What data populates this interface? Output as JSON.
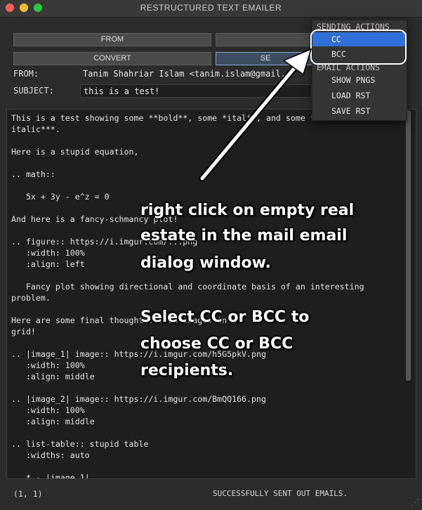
{
  "window": {
    "title": "RESTRUCTURED TEXT EMAILER"
  },
  "buttons": {
    "from": "FROM",
    "convert": "CONVERT",
    "send": "SE"
  },
  "fields": {
    "from_label": "FROM:",
    "from_value": "Tanim Shahriar Islam <tanim.islam@gmail.c",
    "subject_label": "SUBJECT:",
    "subject_value": "this is a test!"
  },
  "body_text": "This is a test showing some **bold**, some *itali*, and some ***bold\nitalic***.\n\nHere is a stupid equation,\n\n.. math::\n\n   5x + 3y - e^z = 0\n\nAnd here is a fancy-schmancy plot!\n\n.. figure:: https://i.imgur.com/...png\n   :width: 100%\n   :align: left\n\n   Fancy plot showing directional and coordinate basis of an interesting\nproblem.\n\nHere are some final thoughts... on images in a\ngrid!\n\n.. |image_1| image:: https://i.imgur.com/h5G5pkV.png\n   :width: 100%\n   :align: middle\n\n.. |image_2| image:: https://i.imgur.com/BmQQ166.png\n   :width: 100%\n   :align: middle\n\n.. list-table:: stupid table\n   :widths: auto\n\n   * - |image_1|",
  "status": {
    "position": "(1, 1)",
    "message": "SUCCESSFULLY SENT OUT EMAILS."
  },
  "context_menu": {
    "sending_header": "SENDING ACTIONS",
    "cc": "CC",
    "bcc": "BCC",
    "email_header": "EMAIL ACTIONS",
    "show_pngs": "SHOW PNGS",
    "load_rst": "LOAD RST",
    "save_rst": "SAVE RST"
  },
  "annotation": {
    "line1": "right click on empty real",
    "line2": "estate in the mail email",
    "line3": "dialog window.",
    "line4": "Select CC or BCC to",
    "line5": "choose CC or BCC",
    "line6": "recipients."
  },
  "colors": {
    "selection": "#2f6fd6",
    "background": "#2b2b2b"
  }
}
